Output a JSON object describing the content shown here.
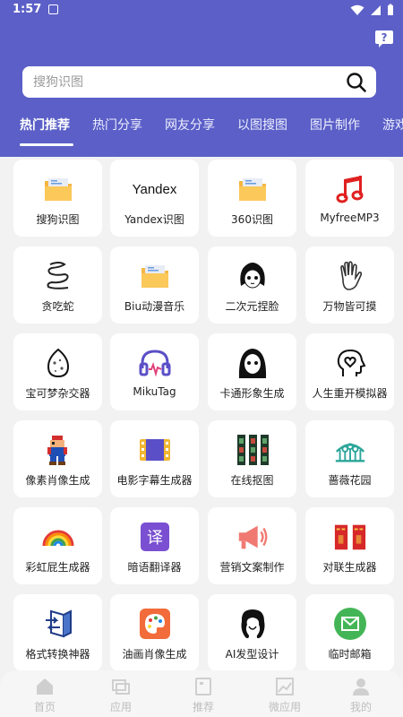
{
  "status_bar": {
    "time": "1:57"
  },
  "search": {
    "placeholder": "搜狗识图"
  },
  "tabs": [
    {
      "label": "热门推荐",
      "active": true
    },
    {
      "label": "热门分享"
    },
    {
      "label": "网友分享"
    },
    {
      "label": "以图搜图"
    },
    {
      "label": "图片制作"
    },
    {
      "label": "游戏"
    }
  ],
  "tools": [
    {
      "label": "搜狗识图",
      "icon": "folder-icon"
    },
    {
      "label": "Yandex",
      "icon": "yandex-logo"
    },
    {
      "label": "Yandex识图",
      "icon": "yandex-logo"
    },
    {
      "label": "360识图",
      "icon": "folder-icon"
    },
    {
      "label": "MyfreeMP3",
      "icon": "music-note-icon"
    },
    {
      "label": "贪吃蛇",
      "icon": "snake-icon"
    },
    {
      "label": "Biu动漫音乐",
      "icon": "folder-icon"
    },
    {
      "label": "二次元捏脸",
      "icon": "anime-face-icon"
    },
    {
      "label": "万物皆可摸",
      "icon": "hand-icon"
    },
    {
      "label": "宝可梦杂交器",
      "icon": "egg-icon"
    },
    {
      "label": "MikuTag",
      "icon": "headphones-icon"
    },
    {
      "label": "卡通形象生成",
      "icon": "ghost-icon"
    },
    {
      "label": "人生重开模拟器",
      "icon": "head-heart-icon"
    },
    {
      "label": "像素肖像生成",
      "icon": "pixel-mario-icon"
    },
    {
      "label": "电影字幕生成器",
      "icon": "film-icon"
    },
    {
      "label": "在线抠图",
      "icon": "film-strip-icon"
    },
    {
      "label": "蔷薇花园",
      "icon": "garden-icon"
    },
    {
      "label": "彩虹屁生成器",
      "icon": "rainbow-icon"
    },
    {
      "label": "暗语翻译器",
      "icon": "translate-icon"
    },
    {
      "label": "营销文案制作",
      "icon": "megaphone-icon"
    },
    {
      "label": "对联生成器",
      "icon": "couplet-icon"
    },
    {
      "label": "格式转换神器",
      "icon": "convert-icon"
    },
    {
      "label": "油画肖像生成",
      "icon": "palette-icon"
    },
    {
      "label": "AI发型设计",
      "icon": "hair-icon"
    },
    {
      "label": "临时邮箱",
      "icon": "mail-icon"
    }
  ],
  "nav": [
    {
      "label": "首页",
      "icon": "home-icon"
    },
    {
      "label": "应用",
      "icon": "apps-icon"
    },
    {
      "label": "推荐",
      "icon": "book-icon"
    },
    {
      "label": "微应用",
      "icon": "chart-icon"
    },
    {
      "label": "我的",
      "icon": "user-icon"
    }
  ],
  "colors": {
    "header": "#5b5fc7",
    "background": "#f2f2f2"
  }
}
